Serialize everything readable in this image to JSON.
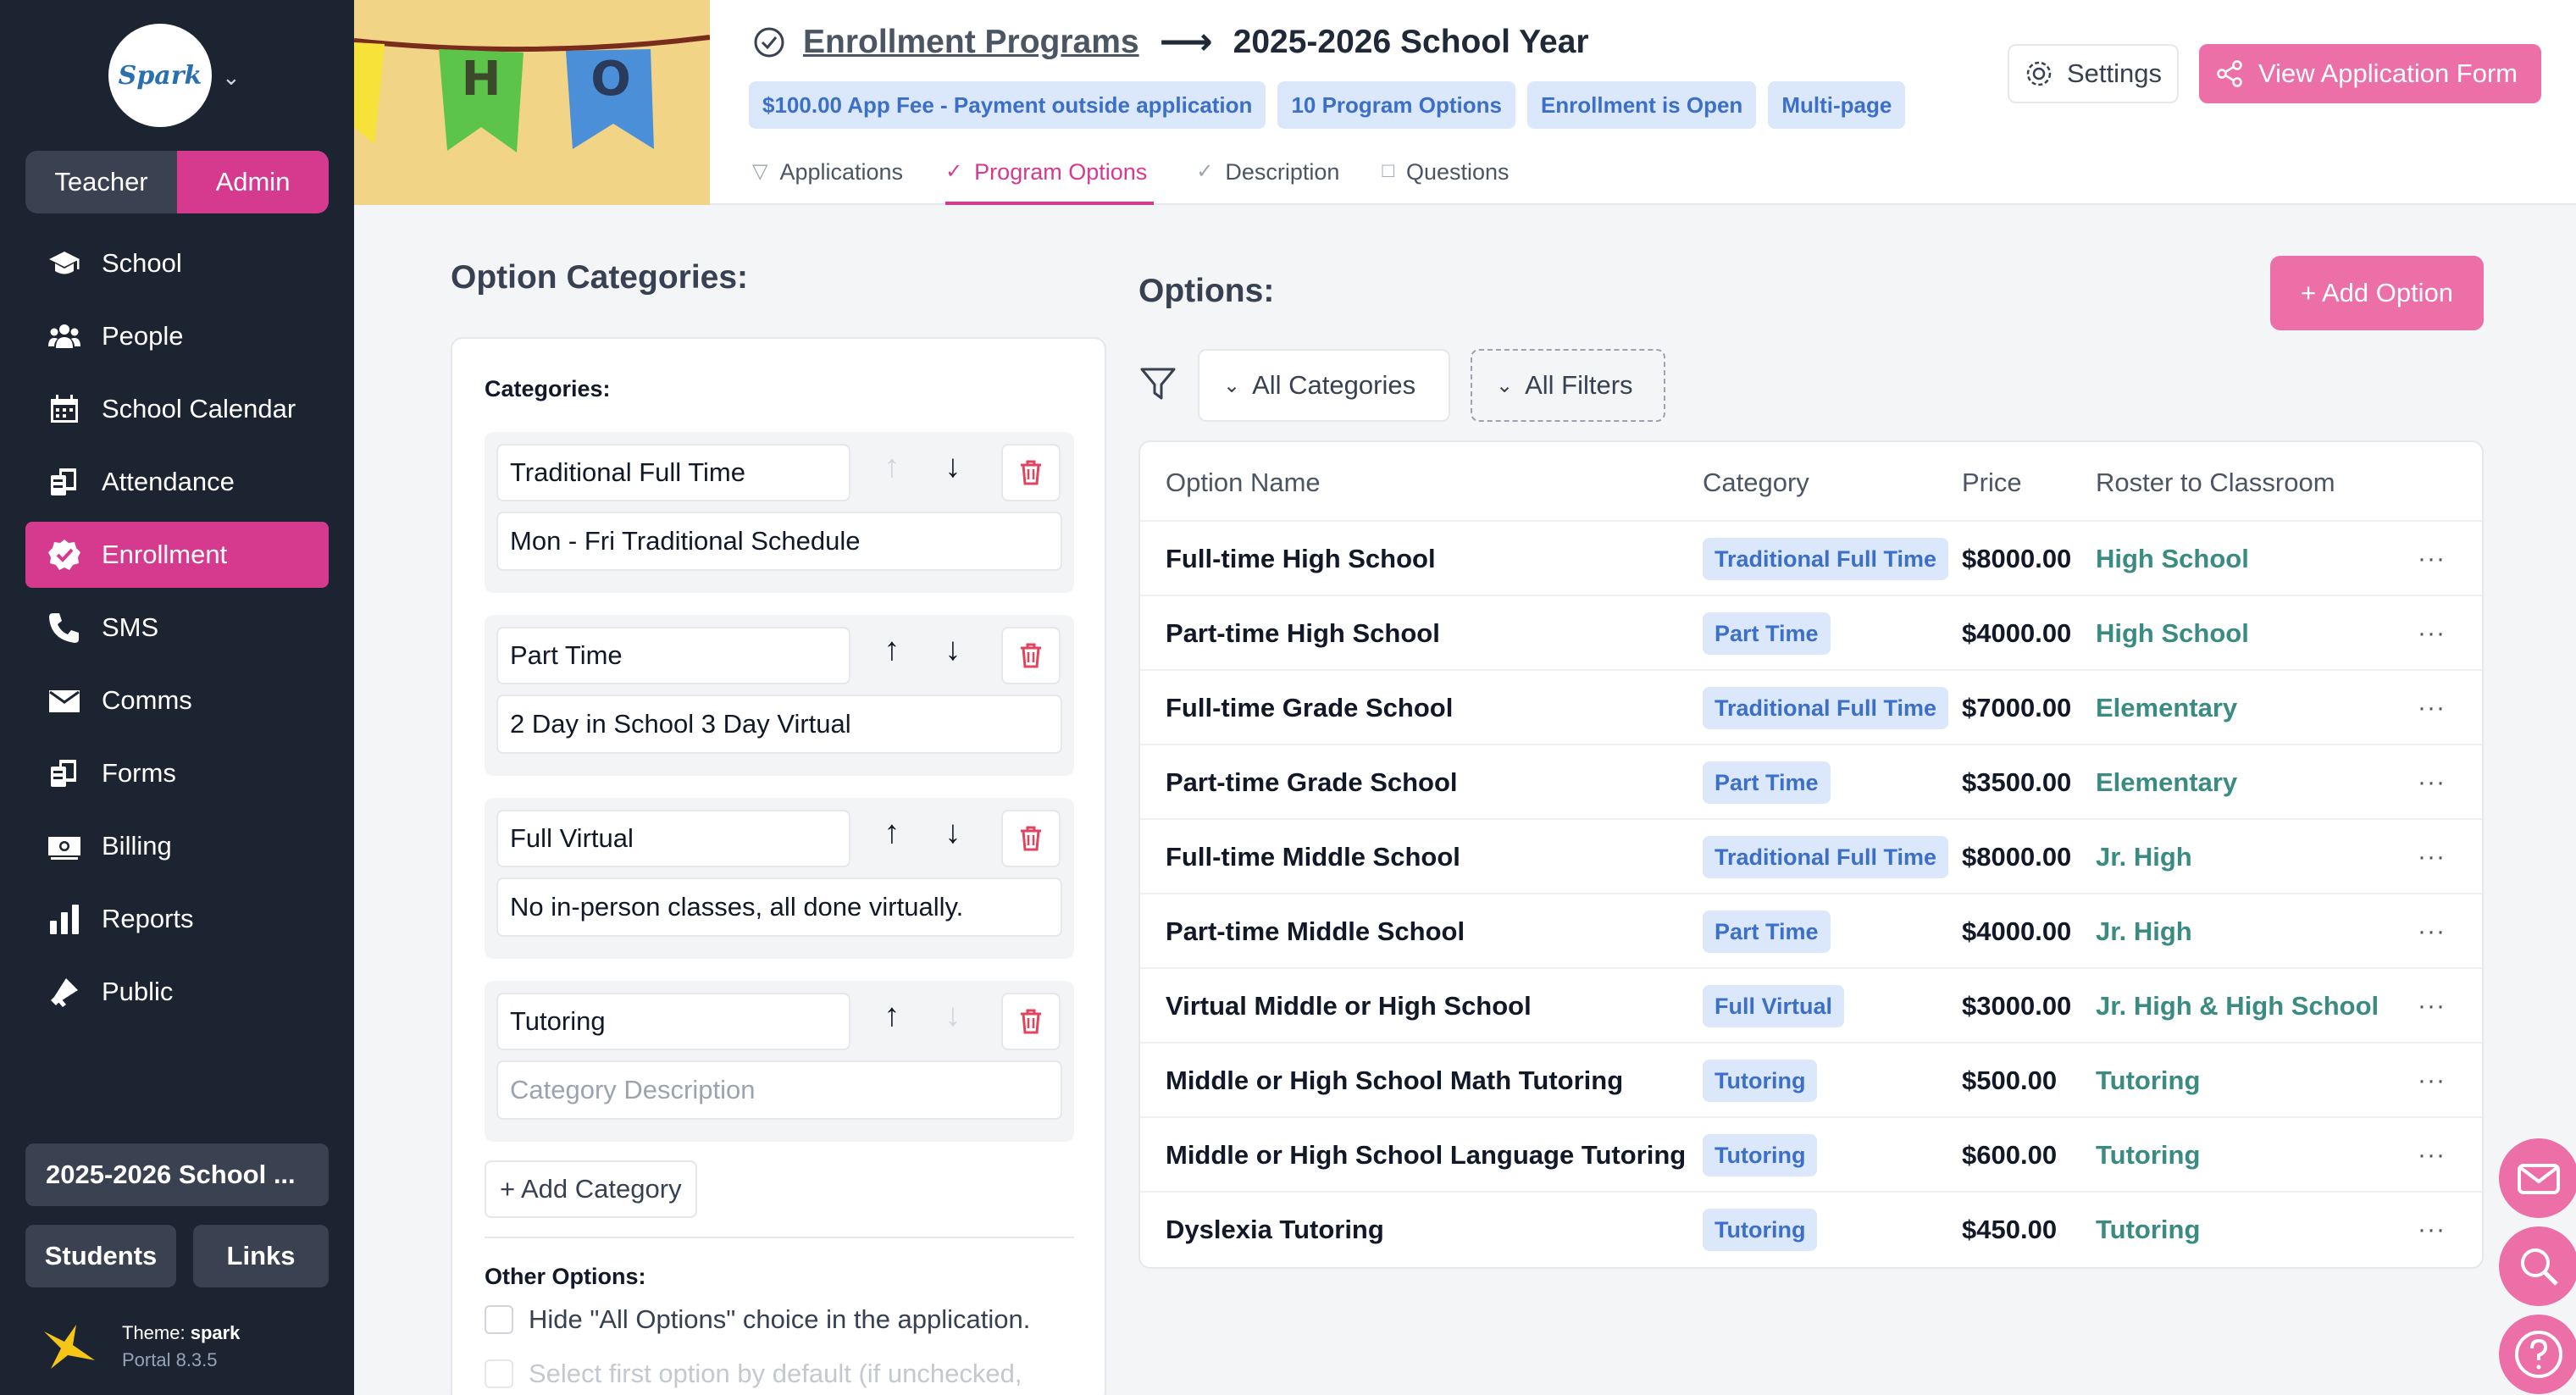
{
  "sidebar": {
    "logo_text": "Spark",
    "roles": {
      "teacher": "Teacher",
      "admin": "Admin"
    },
    "items": [
      {
        "label": "School",
        "icon": "graduation-cap-icon"
      },
      {
        "label": "People",
        "icon": "people-icon"
      },
      {
        "label": "School Calendar",
        "icon": "calendar-icon"
      },
      {
        "label": "Attendance",
        "icon": "attendance-icon"
      },
      {
        "label": "Enrollment",
        "icon": "check-badge-icon"
      },
      {
        "label": "SMS",
        "icon": "phone-icon"
      },
      {
        "label": "Comms",
        "icon": "envelope-icon"
      },
      {
        "label": "Forms",
        "icon": "forms-icon"
      },
      {
        "label": "Billing",
        "icon": "money-icon"
      },
      {
        "label": "Reports",
        "icon": "bar-chart-icon"
      },
      {
        "label": "Public",
        "icon": "bullhorn-icon"
      }
    ],
    "active_item": "Enrollment",
    "year_button": "2025-2026 School ...",
    "students_button": "Students",
    "links_button": "Links",
    "theme_label": "Theme: ",
    "theme_name": "spark",
    "portal_version": "Portal 8.3.5"
  },
  "banner": {
    "letters": [
      "H",
      "O"
    ]
  },
  "header": {
    "breadcrumb_link": "Enrollment Programs",
    "breadcrumb_current": "2025-2026 School Year",
    "badges": [
      "$100.00 App Fee - Payment outside application",
      "10 Program Options",
      "Enrollment is Open",
      "Multi-page"
    ],
    "tabs": [
      {
        "label": "Applications",
        "icon": "filter-icon"
      },
      {
        "label": "Program Options",
        "icon": "check-circle-icon"
      },
      {
        "label": "Description",
        "icon": "check-circle-icon"
      },
      {
        "label": "Questions",
        "icon": "clipboard-icon"
      }
    ],
    "active_tab": "Program Options",
    "settings_label": "Settings",
    "view_form_label": "View Application Form"
  },
  "categories_panel": {
    "title": "Option Categories:",
    "categories_label": "Categories:",
    "categories": [
      {
        "name": "Traditional Full Time",
        "description": "Mon - Fri Traditional Schedule",
        "description_placeholder": "Category Description"
      },
      {
        "name": "Part Time",
        "description": "2 Day in School 3 Day Virtual",
        "description_placeholder": "Category Description"
      },
      {
        "name": "Full Virtual",
        "description": "No in-person classes, all done virtually.",
        "description_placeholder": "Category Description"
      },
      {
        "name": "Tutoring",
        "description": "",
        "description_placeholder": "Category Description"
      }
    ],
    "add_category_label": "+ Add Category",
    "other_options_label": "Other Options:",
    "other_options": [
      "Hide \"All Options\" choice in the application.",
      "Select first option by default (if unchecked,"
    ]
  },
  "options_panel": {
    "title": "Options:",
    "add_option_label": "+ Add Option",
    "category_filter": "All Categories",
    "filters_label": "All Filters",
    "columns": [
      "Option Name",
      "Category",
      "Price",
      "Roster to Classroom"
    ],
    "rows": [
      {
        "name": "Full-time High School",
        "category": "Traditional Full Time",
        "price": "$8000.00",
        "classroom": "High School"
      },
      {
        "name": "Part-time High School",
        "category": "Part Time",
        "price": "$4000.00",
        "classroom": "High School"
      },
      {
        "name": "Full-time Grade School",
        "category": "Traditional Full Time",
        "price": "$7000.00",
        "classroom": "Elementary"
      },
      {
        "name": "Part-time Grade School",
        "category": "Part Time",
        "price": "$3500.00",
        "classroom": "Elementary"
      },
      {
        "name": "Full-time Middle School",
        "category": "Traditional Full Time",
        "price": "$8000.00",
        "classroom": "Jr. High"
      },
      {
        "name": "Part-time Middle School",
        "category": "Part Time",
        "price": "$4000.00",
        "classroom": "Jr. High"
      },
      {
        "name": "Virtual Middle or High School",
        "category": "Full Virtual",
        "price": "$3000.00",
        "classroom": "Jr. High & High School"
      },
      {
        "name": "Middle or High School Math Tutoring",
        "category": "Tutoring",
        "price": "$500.00",
        "classroom": "Tutoring"
      },
      {
        "name": "Middle or High School Language Tutoring",
        "category": "Tutoring",
        "price": "$600.00",
        "classroom": "Tutoring"
      },
      {
        "name": "Dyslexia Tutoring",
        "category": "Tutoring",
        "price": "$450.00",
        "classroom": "Tutoring"
      }
    ],
    "row_menu": "···"
  },
  "colors": {
    "sidebar_bg": "#1c2331",
    "accent_pink": "#d63a8e",
    "button_pink": "#ec6fa8",
    "badge_bg": "#dbe7fb",
    "badge_text": "#3b6fc8",
    "classroom_text": "#3a8c82"
  }
}
